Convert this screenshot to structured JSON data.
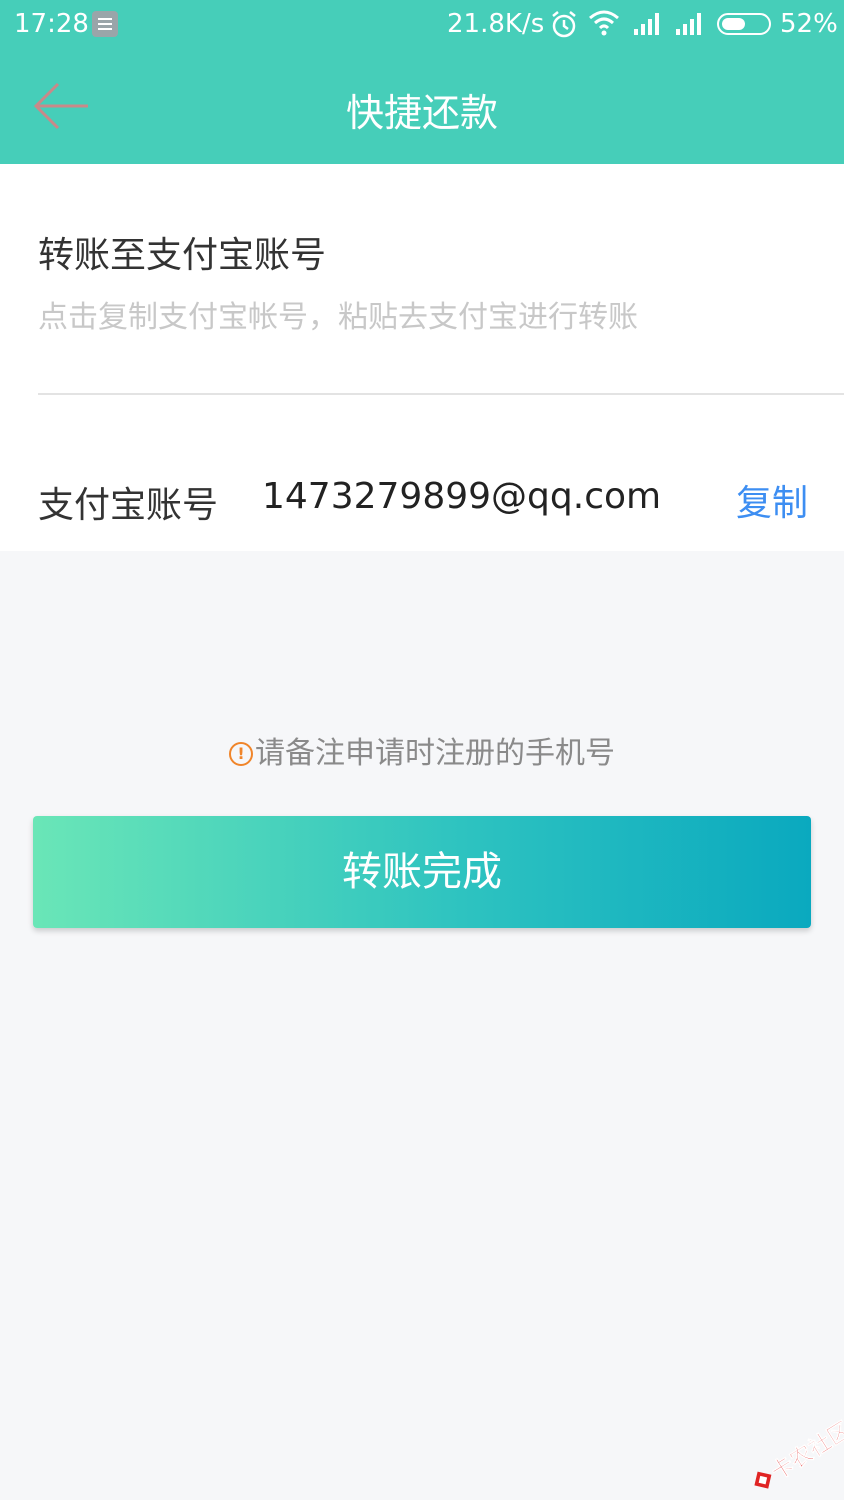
{
  "status_bar": {
    "time": "17:28",
    "net_speed": "21.8K/s",
    "battery_percent": "52%",
    "battery_level": 0.52,
    "icons": [
      "notification-icon",
      "alarm-icon",
      "wifi-icon",
      "signal-icon",
      "signal-icon",
      "battery-icon"
    ]
  },
  "header": {
    "title": "快捷还款",
    "back_icon": "arrow-left-icon",
    "background": "#46ceb9"
  },
  "transfer": {
    "title": "转账至支付宝账号",
    "hint": "点击复制支付宝帐号，粘贴去支付宝进行转账",
    "account_label": "支付宝账号",
    "account_value": "1473279899@qq.com",
    "copy_label": "复制"
  },
  "notice": {
    "icon": "warning-circle-icon",
    "text": "请备注申请时注册的手机号"
  },
  "action": {
    "done_label": "转账完成",
    "gradient_start": "#6ae6b7",
    "gradient_end": "#0aa9bf"
  },
  "watermark": {
    "text": "卡农社区"
  }
}
